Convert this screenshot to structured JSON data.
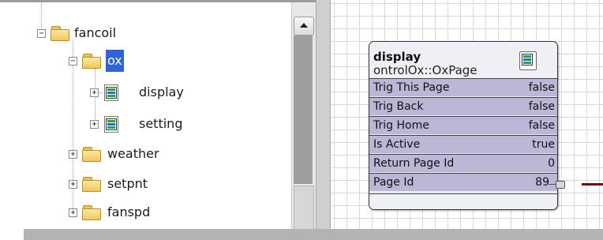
{
  "tree": {
    "items": [
      {
        "label": "fancoil",
        "expander": "−",
        "icon": "folder-icon"
      },
      {
        "label": "ox",
        "expander": "−",
        "icon": "folder-icon",
        "selected": true
      },
      {
        "label": "display",
        "expander": "+",
        "icon": "ox-page-icon"
      },
      {
        "label": "setting",
        "expander": "+",
        "icon": "ox-page-icon"
      },
      {
        "label": "weather",
        "expander": "+",
        "icon": "folder-icon"
      },
      {
        "label": "setpnt",
        "expander": "+",
        "icon": "folder-icon"
      },
      {
        "label": "fanspd",
        "expander": "+",
        "icon": "folder-icon"
      }
    ],
    "selected_color": "#3064d6"
  },
  "component": {
    "name": "display",
    "type": "ontrolOx::OxPage",
    "icon": "ox-page-icon",
    "slots": [
      {
        "name": "Trig This Page",
        "value": "false"
      },
      {
        "name": "Trig Back",
        "value": "false"
      },
      {
        "name": "Trig Home",
        "value": "false"
      },
      {
        "name": "Is Active",
        "value": "true"
      },
      {
        "name": "Return Page Id",
        "value": "0"
      },
      {
        "name": "Page Id",
        "value": "89"
      }
    ],
    "slot_color": "#bdb6d6",
    "link_color": "#7a0000"
  }
}
